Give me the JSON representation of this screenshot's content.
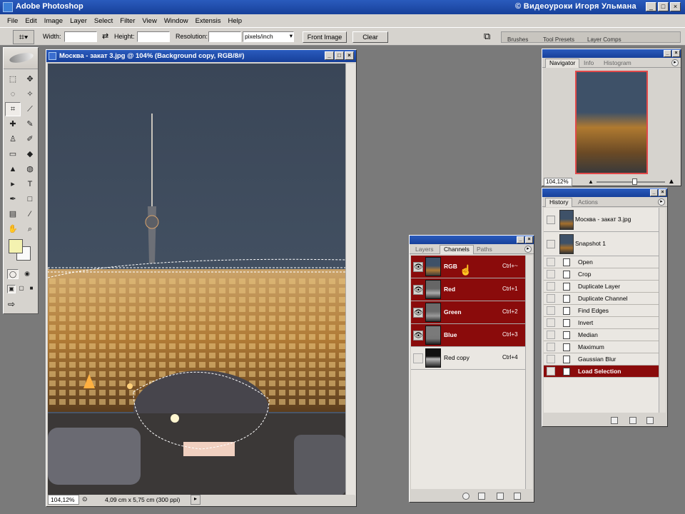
{
  "app": {
    "title": "Adobe Photoshop",
    "watermark": "© Видеоуроки Игоря Ульмана",
    "window_buttons": [
      "_",
      "□",
      "×"
    ]
  },
  "menu": [
    "File",
    "Edit",
    "Image",
    "Layer",
    "Select",
    "Filter",
    "View",
    "Window",
    "Extensis",
    "Help"
  ],
  "options": {
    "width_label": "Width:",
    "width_value": "",
    "height_label": "Height:",
    "height_value": "",
    "resolution_label": "Resolution:",
    "resolution_value": "",
    "units": "pixels/inch",
    "front_image": "Front Image",
    "clear": "Clear",
    "palette_tabs": [
      "Brushes",
      "Tool Presets",
      "Layer Comps"
    ]
  },
  "toolbox": {
    "tools": [
      {
        "name": "marquee-tool-icon",
        "glyph": "⬚"
      },
      {
        "name": "move-tool-icon",
        "glyph": "✥"
      },
      {
        "name": "lasso-tool-icon",
        "glyph": "◌"
      },
      {
        "name": "magic-wand-tool-icon",
        "glyph": "✧"
      },
      {
        "name": "crop-tool-icon",
        "glyph": "⌗"
      },
      {
        "name": "slice-tool-icon",
        "glyph": "⟋"
      },
      {
        "name": "healing-tool-icon",
        "glyph": "✚"
      },
      {
        "name": "brush-tool-icon",
        "glyph": "✎"
      },
      {
        "name": "stamp-tool-icon",
        "glyph": "♙"
      },
      {
        "name": "history-brush-tool-icon",
        "glyph": "✐"
      },
      {
        "name": "eraser-tool-icon",
        "glyph": "▭"
      },
      {
        "name": "bucket-tool-icon",
        "glyph": "◆"
      },
      {
        "name": "blur-tool-icon",
        "glyph": "▲"
      },
      {
        "name": "dodge-tool-icon",
        "glyph": "◍"
      },
      {
        "name": "path-select-tool-icon",
        "glyph": "▸"
      },
      {
        "name": "type-tool-icon",
        "glyph": "T"
      },
      {
        "name": "pen-tool-icon",
        "glyph": "✒"
      },
      {
        "name": "shape-tool-icon",
        "glyph": "□"
      },
      {
        "name": "notes-tool-icon",
        "glyph": "▤"
      },
      {
        "name": "eyedropper-tool-icon",
        "glyph": "⁄"
      },
      {
        "name": "hand-tool-icon",
        "glyph": "✋"
      },
      {
        "name": "zoom-tool-icon",
        "glyph": "⌕"
      }
    ]
  },
  "document": {
    "title": "Москва - закат 3.jpg @ 104% (Background copy, RGB/8#)",
    "zoom": "104,12%",
    "info": "4,09 cm x 5,75 cm (300 ppi)"
  },
  "navigator": {
    "tabs": [
      "Navigator",
      "Info",
      "Histogram"
    ],
    "zoom": "104,12%"
  },
  "history": {
    "tabs": [
      "History",
      "Actions"
    ],
    "snapshots": [
      "Москва - закат 3.jpg",
      "Snapshot 1"
    ],
    "steps": [
      "Open",
      "Crop",
      "Duplicate Layer",
      "Duplicate Channel",
      "Find Edges",
      "Invert",
      "Median",
      "Maximum",
      "Gaussian Blur",
      "Load Selection"
    ]
  },
  "channels": {
    "tabs": [
      "Layers",
      "Channels",
      "Paths"
    ],
    "rows": [
      {
        "name": "RGB",
        "key": "Ctrl+~"
      },
      {
        "name": "Red",
        "key": "Ctrl+1"
      },
      {
        "name": "Green",
        "key": "Ctrl+2"
      },
      {
        "name": "Blue",
        "key": "Ctrl+3"
      },
      {
        "name": "Red copy",
        "key": "Ctrl+4"
      }
    ]
  },
  "colors": {
    "title_bar": "#17409a",
    "selection": "#8a0b0b",
    "chrome": "#d6d3ce",
    "workspace": "#7a7a7a",
    "foreground_swatch": "#f4f2b0"
  }
}
